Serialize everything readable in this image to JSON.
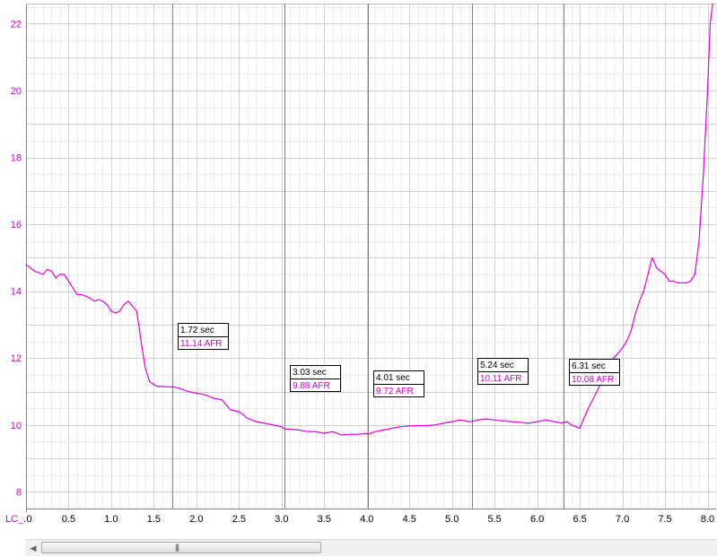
{
  "chart_data": {
    "type": "line",
    "title": "",
    "xlabel": "",
    "ylabel": "",
    "xlim": [
      0,
      8.1
    ],
    "ylim": [
      7.5,
      22.6
    ],
    "x_ticks": [
      ".0",
      "0.5",
      "1.0",
      "1.5",
      "2.0",
      "2.5",
      "3.0",
      "3.5",
      "4.0",
      "4.5",
      "5.0",
      "5.5",
      "6.0",
      "6.5",
      "7.0",
      "7.5",
      "8.0"
    ],
    "y_ticks": [
      "8",
      "10",
      "12",
      "14",
      "16",
      "18",
      "20",
      "22"
    ],
    "series_axis_label": "LC_",
    "grid": true,
    "series": [
      {
        "color": "#e000e0",
        "x": [
          0,
          0.1,
          0.15,
          0.2,
          0.25,
          0.3,
          0.35,
          0.4,
          0.45,
          0.5,
          0.55,
          0.6,
          0.65,
          0.7,
          0.75,
          0.8,
          0.85,
          0.9,
          0.95,
          1.0,
          1.05,
          1.1,
          1.15,
          1.2,
          1.25,
          1.3,
          1.35,
          1.4,
          1.45,
          1.5,
          1.55,
          1.6,
          1.65,
          1.72,
          1.8,
          1.9,
          2.0,
          2.1,
          2.2,
          2.3,
          2.4,
          2.5,
          2.6,
          2.7,
          2.8,
          3.0,
          3.03,
          3.1,
          3.2,
          3.3,
          3.4,
          3.5,
          3.6,
          3.7,
          3.8,
          3.9,
          4.0,
          4.01,
          4.1,
          4.2,
          4.3,
          4.4,
          4.5,
          4.6,
          4.7,
          4.8,
          4.9,
          5.0,
          5.1,
          5.2,
          5.24,
          5.3,
          5.4,
          5.5,
          5.6,
          5.7,
          5.8,
          5.9,
          6.0,
          6.1,
          6.2,
          6.3,
          6.31,
          6.35,
          6.4,
          6.45,
          6.5,
          6.6,
          6.7,
          6.8,
          6.9,
          7.0,
          7.05,
          7.1,
          7.15,
          7.2,
          7.25,
          7.3,
          7.35,
          7.4,
          7.45,
          7.5,
          7.55,
          7.6,
          7.65,
          7.7,
          7.75,
          7.8,
          7.85,
          7.9,
          7.95,
          8.0,
          8.03,
          8.06
        ],
        "values": [
          14.8,
          14.6,
          14.55,
          14.5,
          14.65,
          14.6,
          14.4,
          14.5,
          14.5,
          14.3,
          14.1,
          13.9,
          13.9,
          13.85,
          13.8,
          13.7,
          13.75,
          13.7,
          13.6,
          13.4,
          13.35,
          13.4,
          13.6,
          13.7,
          13.55,
          13.4,
          12.5,
          11.7,
          11.3,
          11.2,
          11.15,
          11.15,
          11.14,
          11.14,
          11.1,
          11.0,
          10.95,
          10.9,
          10.8,
          10.75,
          10.45,
          10.4,
          10.2,
          10.1,
          10.05,
          9.95,
          9.88,
          9.87,
          9.85,
          9.8,
          9.8,
          9.75,
          9.8,
          9.7,
          9.72,
          9.72,
          9.75,
          9.72,
          9.8,
          9.85,
          9.9,
          9.95,
          9.97,
          9.98,
          9.98,
          10.0,
          10.05,
          10.1,
          10.15,
          10.1,
          10.11,
          10.15,
          10.18,
          10.15,
          10.12,
          10.1,
          10.08,
          10.05,
          10.1,
          10.15,
          10.1,
          10.05,
          10.08,
          10.1,
          10.0,
          9.95,
          9.9,
          10.5,
          11.0,
          11.5,
          12.0,
          12.3,
          12.5,
          12.8,
          13.3,
          13.7,
          14.0,
          14.5,
          15.0,
          14.7,
          14.6,
          14.5,
          14.3,
          14.3,
          14.25,
          14.25,
          14.25,
          14.3,
          14.5,
          15.5,
          17.5,
          20.0,
          22.0,
          22.6
        ]
      }
    ],
    "cursors": [
      {
        "x": 1.72,
        "time_label": "1.72 sec",
        "value_label": "11.14 AFR"
      },
      {
        "x": 3.03,
        "time_label": "3.03 sec",
        "value_label": "9.88 AFR"
      },
      {
        "x": 4.01,
        "time_label": "4.01 sec",
        "value_label": "9.72 AFR"
      },
      {
        "x": 5.24,
        "time_label": "5.24 sec",
        "value_label": "10.11 AFR"
      },
      {
        "x": 6.31,
        "time_label": "6.31 sec",
        "value_label": "10.08 AFR"
      }
    ]
  },
  "scrollbar": {
    "left_arrow": "◀",
    "grip": "|||"
  }
}
